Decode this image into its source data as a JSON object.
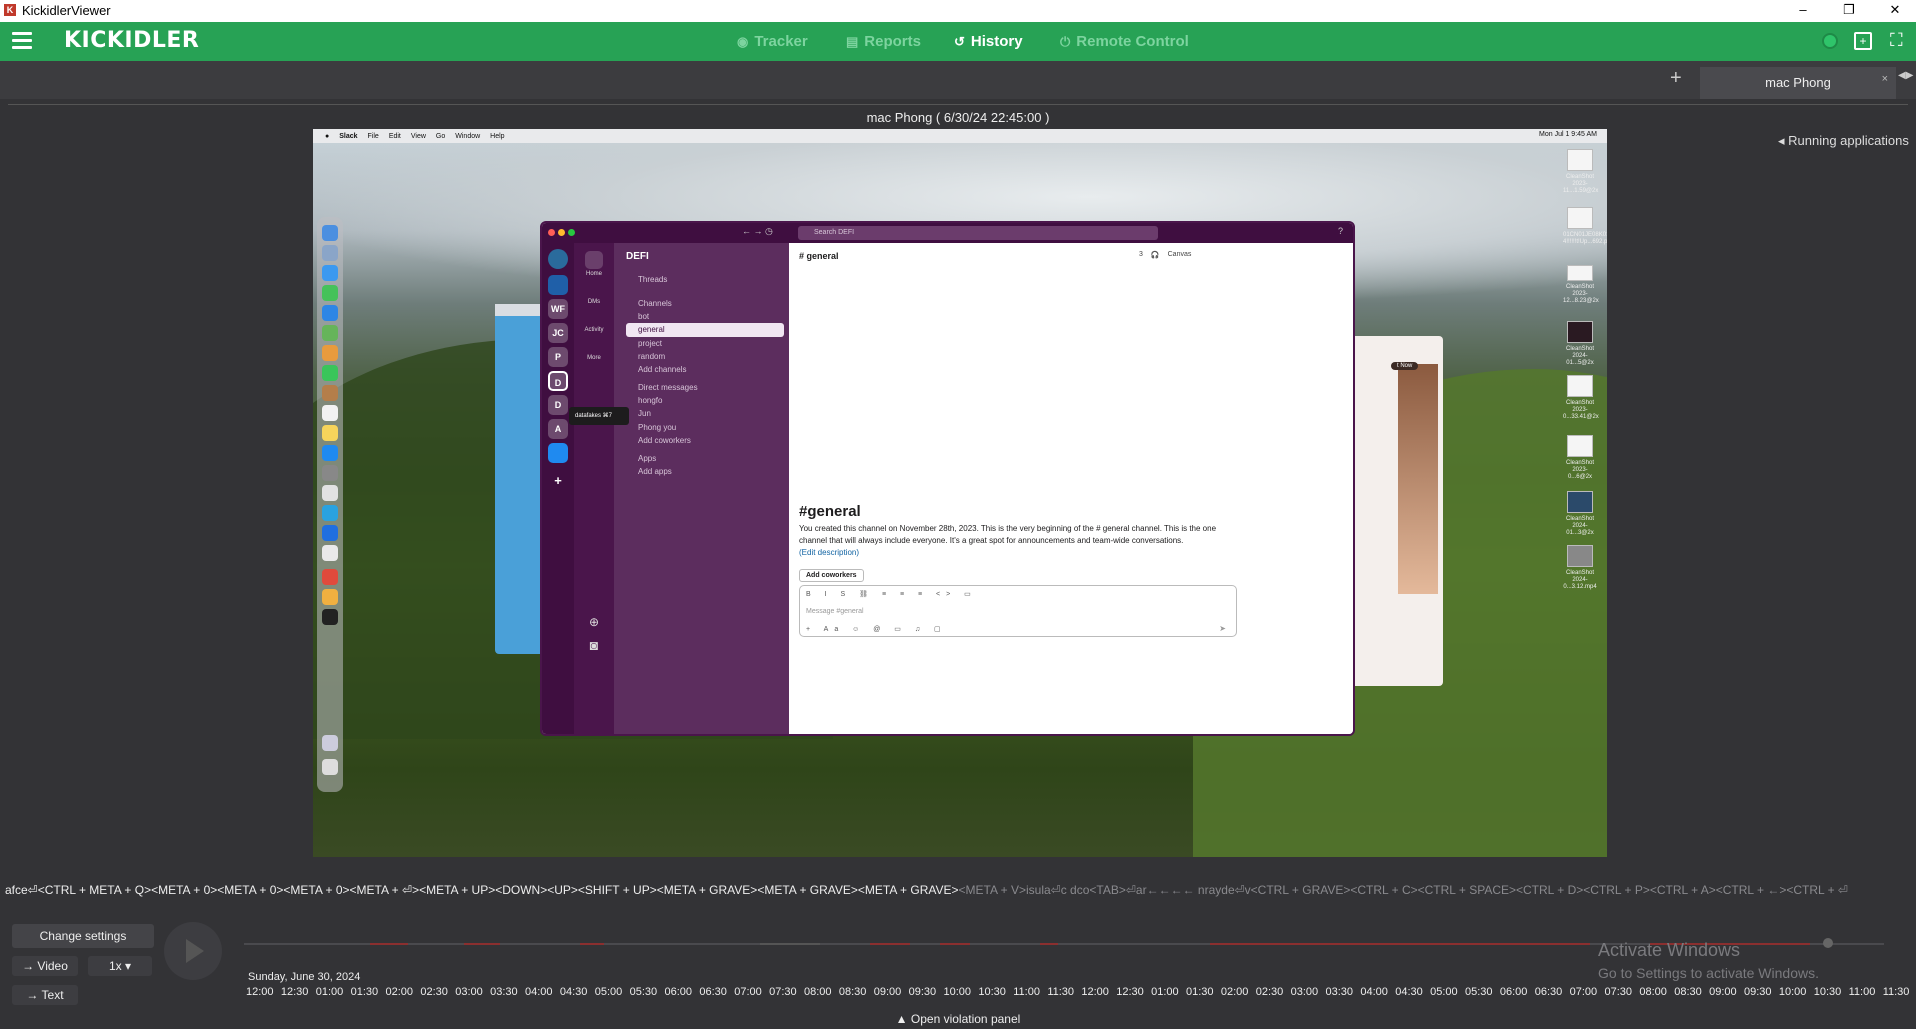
{
  "window": {
    "title": "KickidlerViewer",
    "minimize": "–",
    "restore": "❐",
    "close": "✕"
  },
  "topnav": {
    "brand": "KICKIDLER",
    "items": [
      {
        "label": "Tracker",
        "icon": "eye-icon"
      },
      {
        "label": "Reports",
        "icon": "document-icon"
      },
      {
        "label": "History",
        "icon": "history-icon"
      },
      {
        "label": "Remote Control",
        "icon": "power-icon"
      }
    ],
    "status_color": "#2fc46a"
  },
  "tabs": {
    "add": "+",
    "active": "mac Phong",
    "close": "×"
  },
  "viewer": {
    "caption": "mac Phong   ( 6/30/24 22:45:00 )",
    "running_apps": "Running applications"
  },
  "screenshot": {
    "menubar": {
      "items": [
        "Slack",
        "File",
        "Edit",
        "View",
        "Go",
        "Window",
        "Help"
      ],
      "clock": "Mon Jul 1  9:45 AM"
    },
    "slack": {
      "search_placeholder": "Search DEFI",
      "workspace": "DEFI",
      "rail_workspaces": [
        "WF",
        "JC",
        "P",
        "D",
        "D",
        "A"
      ],
      "nav": [
        "Home",
        "DMs",
        "Activity",
        "More"
      ],
      "tooltip": "datafakes  ⌘7",
      "sidebar": {
        "threads": "Threads",
        "channels_header": "Channels",
        "channels": [
          "bot",
          "general",
          "project",
          "random"
        ],
        "add_channels": "Add channels",
        "dm_header": "Direct messages",
        "dms": [
          "hongfo",
          "Jun",
          "Phong  you"
        ],
        "add_coworkers": "Add coworkers",
        "apps_header": "Apps",
        "add_apps": "Add apps"
      },
      "channel": {
        "header": "# general",
        "members": "3",
        "canvas": "Canvas",
        "big_title": "#general",
        "description": "You created this channel on November 28th, 2023. This is the very beginning of the # general channel. This is the one channel that will always include everyone. It's a great spot for announcements and team-wide conversations.",
        "edit_link": "(Edit description)",
        "add_coworkers_btn": "Add coworkers",
        "composer_placeholder": "Message #general"
      }
    },
    "desktop_files": [
      "CleanShot 2023-11...1.59@2x",
      "01CN01JE08K01O 4!!!!!!t!Up...692.pdf",
      "CleanShot 2023-12...8.23@2x",
      "CleanShot 2024-01...5@2x",
      "CleanShot 2023-0...33.41@2x",
      "CleanShot 2023-0...6@2x",
      "CleanShot 2024-01...3@2x",
      "CleanShot 2024-0...3.12.mp4"
    ],
    "right_window_pill": "t Now"
  },
  "keylog": {
    "active": "afce⏎<CTRL + META + Q><META + 0><META + 0><META + 0><META + ⏎><META + UP><DOWN><UP><SHIFT + UP><META + GRAVE><META + GRAVE><META + GRAVE>",
    "rest": "<META + V>isula⏎c dco<TAB>⏎ar←←←← nrayde⏎v<CTRL + GRAVE><CTRL + C><CTRL + SPACE><CTRL + D><CTRL + P><CTRL + A><CTRL + ←><CTRL + ⏎"
  },
  "controls": {
    "change_settings": "Change settings",
    "video": "Video",
    "speed": "1x",
    "text": "Text",
    "open_violation": "Open violation panel"
  },
  "timeline": {
    "date": "Sunday, June 30, 2024",
    "times": [
      "12:00",
      "12:30",
      "01:00",
      "01:30",
      "02:00",
      "02:30",
      "03:00",
      "03:30",
      "04:00",
      "04:30",
      "05:00",
      "05:30",
      "06:00",
      "06:30",
      "07:00",
      "07:30",
      "08:00",
      "08:30",
      "09:00",
      "09:30",
      "10:00",
      "10:30",
      "11:00",
      "11:30",
      "12:00",
      "12:30",
      "01:00",
      "01:30",
      "02:00",
      "02:30",
      "03:00",
      "03:30",
      "04:00",
      "04:30",
      "05:00",
      "05:30",
      "06:00",
      "06:30",
      "07:00",
      "07:30",
      "08:00",
      "08:30",
      "09:00",
      "09:30",
      "10:00",
      "10:30",
      "11:00",
      "11:30"
    ]
  },
  "watermark": {
    "line1": "Activate Windows",
    "line2": "Go to Settings to activate Windows."
  }
}
